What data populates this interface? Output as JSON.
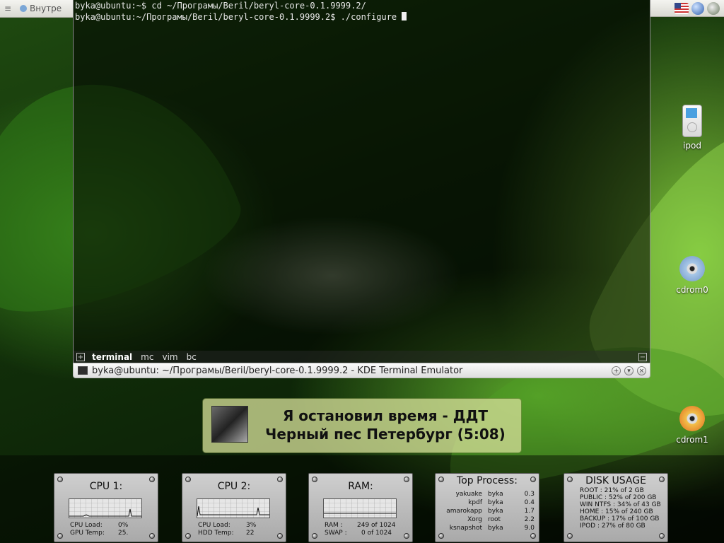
{
  "taskbar": {
    "left_task_label": "Внутре",
    "tray_icons": [
      "flag-us-icon",
      "globe-icon",
      "network-icon"
    ]
  },
  "terminal": {
    "lines": [
      "byka@ubuntu:~$ cd ~/Програмы/Beril/beryl-core-0.1.9999.2/",
      "byka@ubuntu:~/Програмы/Beril/beryl-core-0.1.9999.2$ ./configure "
    ],
    "tabs": [
      "terminal",
      "mc",
      "vim",
      "bc"
    ],
    "active_tab": "terminal",
    "title": "byka@ubuntu: ~/Програмы/Beril/beryl-core-0.1.9999.2 - KDE Terminal Emulator"
  },
  "desktop_icons": [
    {
      "name": "ipod-icon",
      "label": "ipod"
    },
    {
      "name": "dvd-icon",
      "label": "cdrom0"
    },
    {
      "name": "cdr-icon",
      "label": "cdrom1"
    }
  ],
  "now_playing": {
    "title": "Я остановил время - ДДТ",
    "subtitle": "Черный пес Петербург (5:08)"
  },
  "widgets": {
    "cpu1": {
      "title": "CPU 1:",
      "load_label": "CPU Load:",
      "load_value": "0%",
      "temp_label": "GPU Temp:",
      "temp_value": "25."
    },
    "cpu2": {
      "title": "CPU 2:",
      "load_label": "CPU Load:",
      "load_value": "3%",
      "temp_label": "HDD Temp:",
      "temp_value": "22"
    },
    "ram": {
      "title": "RAM:",
      "ram_label": "RAM :",
      "ram_value": "249 of 1024",
      "swap_label": "SWAP :",
      "swap_value": "0 of 1024"
    },
    "top_process": {
      "title": "Top Process:",
      "rows": [
        {
          "name": "yakuake",
          "user": "byka",
          "cpu": "0.3"
        },
        {
          "name": "kpdf",
          "user": "byka",
          "cpu": "0.4"
        },
        {
          "name": "amarokapp",
          "user": "byka",
          "cpu": "1.7"
        },
        {
          "name": "Xorg",
          "user": "root",
          "cpu": "2.2"
        },
        {
          "name": "ksnapshot",
          "user": "byka",
          "cpu": "9.0"
        }
      ]
    },
    "disk_usage": {
      "title": "DISK USAGE",
      "rows": [
        "ROOT : 21% of 2 GB",
        "PUBLIC : 52% of 200 GB",
        "WIN NTFS : 34% of 43 GB",
        "HOME : 15% of 240 GB",
        "BACKUP : 17% of 100 GB",
        "IPOD : 27% of 80 GB"
      ]
    }
  }
}
